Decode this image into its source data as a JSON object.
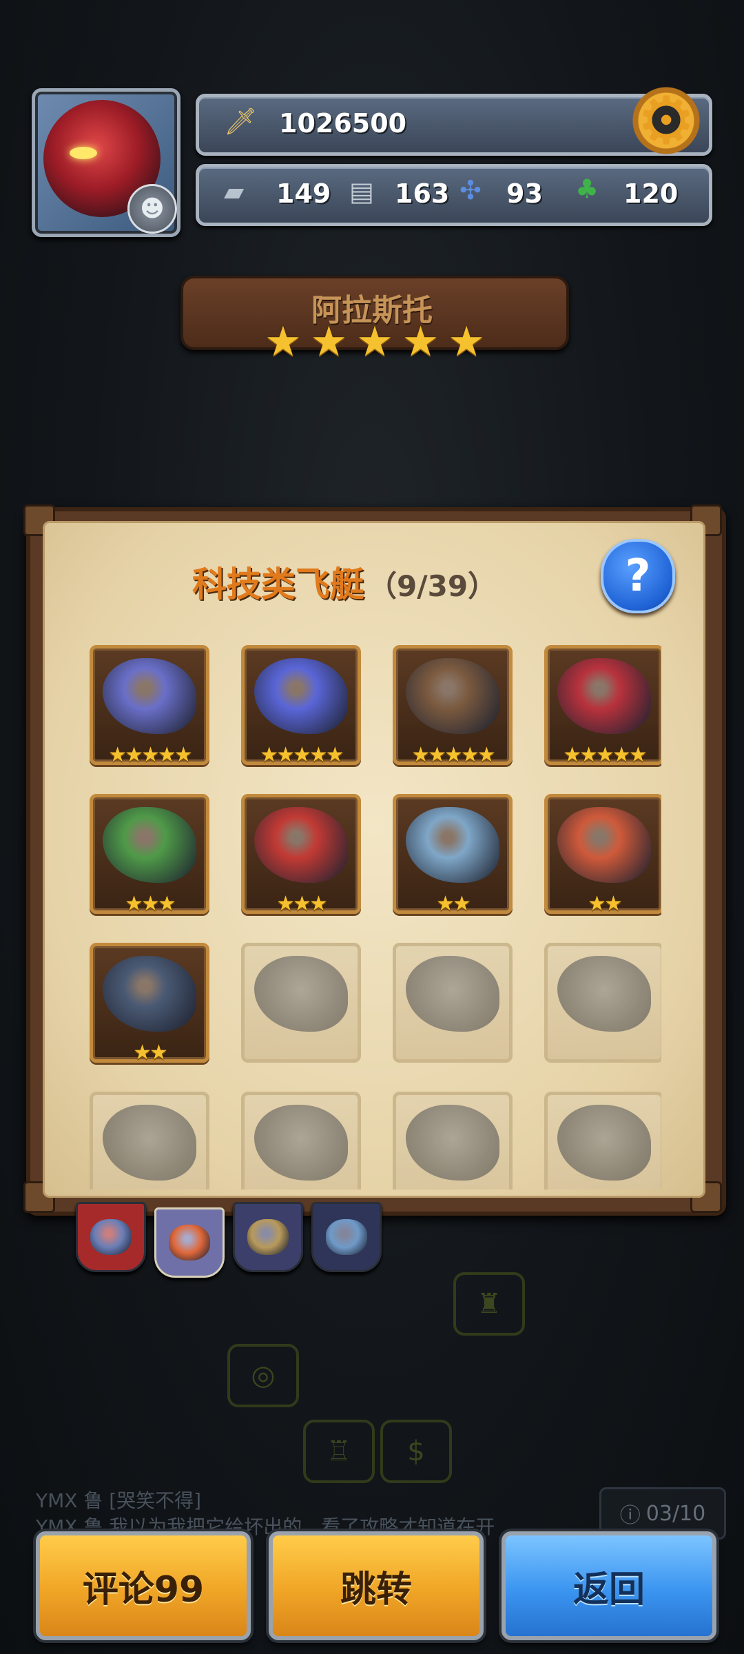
{
  "hud": {
    "power": "1026500",
    "resources": [
      {
        "icon": "tank-icon",
        "value": "149"
      },
      {
        "icon": "armor-plate-icon",
        "value": "163"
      },
      {
        "icon": "propeller-icon",
        "value": "93"
      },
      {
        "icon": "clover-icon",
        "value": "120"
      }
    ]
  },
  "hero": {
    "name": "阿拉斯托",
    "stars": 5
  },
  "panel": {
    "title": "科技类飞艇",
    "count": "（9/39）",
    "ships": [
      {
        "name": "ship-1",
        "owned": true,
        "stars": 5,
        "color": "#6a6fc9"
      },
      {
        "name": "ship-2",
        "owned": true,
        "stars": 5,
        "color": "#5a66d8"
      },
      {
        "name": "ship-3",
        "owned": true,
        "stars": 5,
        "color": "#7b5a3f"
      },
      {
        "name": "ship-4",
        "owned": true,
        "stars": 5,
        "color": "#b8323c"
      },
      {
        "name": "ship-5",
        "owned": true,
        "stars": 3,
        "color": "#4f9a48"
      },
      {
        "name": "ship-6",
        "owned": true,
        "stars": 3,
        "color": "#c23a34"
      },
      {
        "name": "ship-7",
        "owned": true,
        "stars": 2,
        "color": "#7fa7c8"
      },
      {
        "name": "ship-8",
        "owned": true,
        "stars": 2,
        "color": "#cf5a3a"
      },
      {
        "name": "ship-9",
        "owned": true,
        "stars": 2,
        "color": "#4a5a74"
      },
      {
        "name": "ship-10",
        "owned": false,
        "stars": 0,
        "color": "#777777"
      },
      {
        "name": "ship-11",
        "owned": false,
        "stars": 0,
        "color": "#777777"
      },
      {
        "name": "ship-12",
        "owned": false,
        "stars": 0,
        "color": "#777777"
      },
      {
        "name": "ship-13",
        "owned": false,
        "stars": 0,
        "color": "#777777"
      },
      {
        "name": "ship-14",
        "owned": false,
        "stars": 0,
        "color": "#777777"
      },
      {
        "name": "ship-15",
        "owned": false,
        "stars": 0,
        "color": "#777777"
      },
      {
        "name": "ship-16",
        "owned": false,
        "stars": 0,
        "color": "#777777"
      }
    ]
  },
  "tabs": [
    {
      "name": "tab-red",
      "color": "#a72a2a",
      "icon_color": "#6a7fb8"
    },
    {
      "name": "tab-tech",
      "color": "#6f70a8",
      "icon_color": "#e0683a"
    },
    {
      "name": "tab-blue",
      "color": "#3c3f6a",
      "icon_color": "#b89a5a"
    },
    {
      "name": "tab-navy",
      "color": "#2f3558",
      "icon_color": "#6f9ac8"
    }
  ],
  "chat": {
    "line1": "YMX 鲁 [哭笑不得]",
    "line2": "YMX 鲁 我以为我把它给坏出的，看了攻略才知道在开"
  },
  "page_indicator": "03/10",
  "buttons": {
    "comment": "评论99",
    "jump": "跳转",
    "back": "返回"
  },
  "colors": {
    "gold_star": "#f6c12e",
    "title_orange": "#e07a1c",
    "help_blue": "#1f63d6"
  }
}
